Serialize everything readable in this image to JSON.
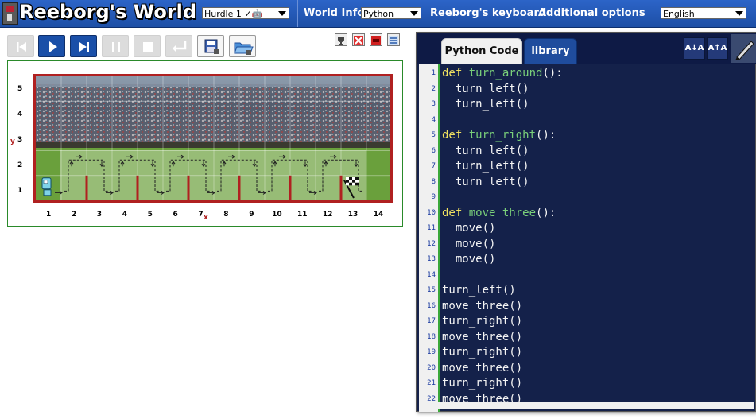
{
  "app": {
    "title": "Reeborg's World"
  },
  "header": {
    "world_select": "Hurdle 1 ✓🤖",
    "world_info_label": "World Info",
    "language_select": "Python",
    "keyboard_label": "Reeborg's keyboard",
    "options_label": "Additional options",
    "ui_language_select": "English"
  },
  "toolbar": {
    "buttons": [
      "reverse-step",
      "run",
      "step",
      "pause",
      "stop",
      "reload",
      "save-file",
      "open-file"
    ],
    "disabled": [
      "reverse-step",
      "pause",
      "stop",
      "reload"
    ],
    "small_buttons": [
      "trophy",
      "erase",
      "flag",
      "list"
    ]
  },
  "world": {
    "x_ticks": [
      "1",
      "2",
      "3",
      "4",
      "5",
      "6",
      "7",
      "8",
      "9",
      "10",
      "11",
      "12",
      "13",
      "14"
    ],
    "y_ticks": [
      "1",
      "2",
      "3",
      "4",
      "5"
    ],
    "x_label": "x",
    "y_label": "y",
    "wall_columns": [
      2,
      4,
      6,
      8,
      10,
      12
    ],
    "robot_position": [
      1,
      1
    ],
    "goal_position": [
      13,
      1
    ],
    "trace_color": "#222222",
    "wall_color": "#b02020"
  },
  "editor": {
    "tabs": [
      "Python Code",
      "library"
    ],
    "active_tab": "Python Code",
    "tool_icons": [
      "A↓A",
      "A↑A"
    ],
    "lines": [
      {
        "n": "1",
        "text": "def turn_around():",
        "kw": "def",
        "fn": "turn_around",
        "rest": "():"
      },
      {
        "n": "2",
        "text": "  turn_left()"
      },
      {
        "n": "3",
        "text": "  turn_left()"
      },
      {
        "n": "4",
        "text": ""
      },
      {
        "n": "5",
        "text": "def turn_right():",
        "kw": "def",
        "fn": "turn_right",
        "rest": "():"
      },
      {
        "n": "6",
        "text": "  turn_left()"
      },
      {
        "n": "7",
        "text": "  turn_left()"
      },
      {
        "n": "8",
        "text": "  turn_left()"
      },
      {
        "n": "9",
        "text": ""
      },
      {
        "n": "10",
        "text": "def move_three():",
        "kw": "def",
        "fn": "move_three",
        "rest": "():"
      },
      {
        "n": "11",
        "text": "  move()"
      },
      {
        "n": "12",
        "text": "  move()"
      },
      {
        "n": "13",
        "text": "  move()"
      },
      {
        "n": "14",
        "text": ""
      },
      {
        "n": "15",
        "text": "turn_left()"
      },
      {
        "n": "16",
        "text": "move_three()"
      },
      {
        "n": "17",
        "text": "turn_right()"
      },
      {
        "n": "18",
        "text": "move_three()"
      },
      {
        "n": "19",
        "text": "turn_right()"
      },
      {
        "n": "20",
        "text": "move_three()"
      },
      {
        "n": "21",
        "text": "turn_right()"
      },
      {
        "n": "22",
        "text": "move_three()"
      }
    ]
  }
}
